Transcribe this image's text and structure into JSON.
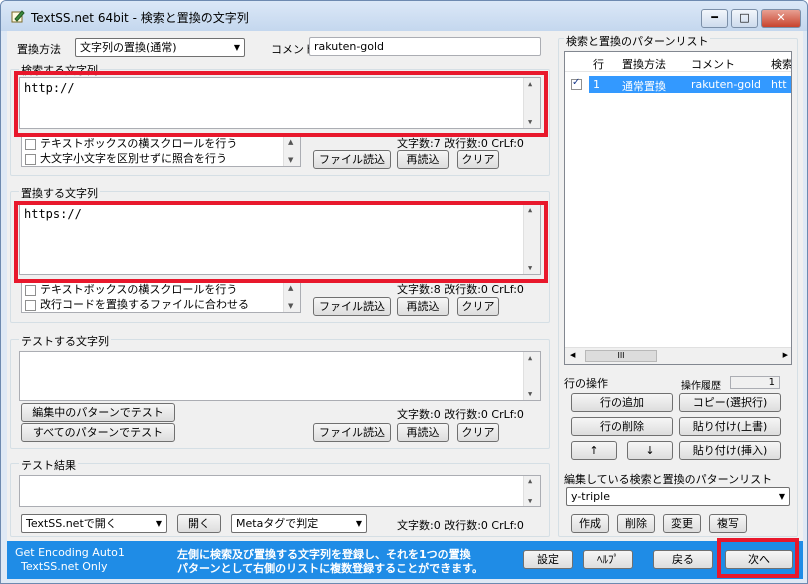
{
  "window": {
    "title": "TextSS.net 64bit - 検索と置換の文字列",
    "min_icon": "minimize-icon",
    "max_icon": "maximize-icon",
    "close_icon": "close-icon",
    "min_glyph": "━",
    "max_glyph": "□",
    "close_glyph": "✕"
  },
  "top": {
    "method_label": "置換方法",
    "method_value": "文字列の置換(通常)",
    "comment_label": "コメント",
    "comment_value": "rakuten-gold"
  },
  "search": {
    "group_label": "検索する文字列",
    "text": "http://",
    "options": [
      "テキストボックスの横スクロールを行う",
      "大文字小文字を区別せずに照合を行う"
    ],
    "stats": "文字数:7  改行数:0  CrLf:0",
    "load_label": "ファイル読込",
    "reload_label": "再読込",
    "clear_label": "クリア"
  },
  "replace": {
    "group_label": "置換する文字列",
    "text": "https://",
    "options": [
      "テキストボックスの横スクロールを行う",
      "改行コードを置換するファイルに合わせる"
    ],
    "stats": "文字数:8  改行数:0  CrLf:0",
    "load_label": "ファイル読込",
    "reload_label": "再読込",
    "clear_label": "クリア"
  },
  "test": {
    "group_label": "テストする文字列",
    "test_edit_label": "編集中のパターンでテスト",
    "test_all_label": "すべてのパターンでテスト",
    "stats": "文字数:0  改行数:0  CrLf:0",
    "load_label": "ファイル読込",
    "reload_label": "再読込",
    "clear_label": "クリア"
  },
  "result": {
    "group_label": "テスト結果",
    "open_with_value": "TextSS.netで開く",
    "open_label": "開く",
    "meta_value": "Metaタグで判定",
    "stats": "文字数:0  改行数:0  CrLf:0"
  },
  "pattern_list": {
    "group_label": "検索と置換のパターンリスト",
    "columns": [
      "行",
      "置換方法",
      "コメント",
      "検索"
    ],
    "rows": [
      {
        "checked": true,
        "row": "1",
        "method": "通常置換",
        "comment": "rakuten-gold",
        "search": "htt"
      }
    ],
    "scroll_mid": "III"
  },
  "row_ops": {
    "label": "行の操作",
    "history_label": "操作履歴",
    "history_value": "1",
    "add_label": "行の追加",
    "copy_label": "コピー(選択行)",
    "delete_label": "行の削除",
    "paste_over_label": "貼り付け(上書)",
    "up_label": "↑",
    "down_label": "↓",
    "paste_insert_label": "貼り付け(挿入)"
  },
  "editing_list": {
    "label": "編集している検索と置換のパターンリスト",
    "value": "y-triple",
    "create_label": "作成",
    "delete_label": "削除",
    "change_label": "変更",
    "duplicate_label": "複写"
  },
  "bottom": {
    "status_line1": "Get Encoding Auto1",
    "status_line2": "TextSS.net Only",
    "message_line1": "左側に検索及び置換する文字列を登録し、それを1つの置換",
    "message_line2": "パターンとして右側のリストに複数登録することができます。",
    "settings_label": "設定",
    "help_label": "ﾍﾙﾌﾟ",
    "back_label": "戻る",
    "next_label": "次へ"
  },
  "colors": {
    "highlight": "#e8182c",
    "status_bar": "#1f8ce6",
    "selected_row": "#3399ff"
  }
}
